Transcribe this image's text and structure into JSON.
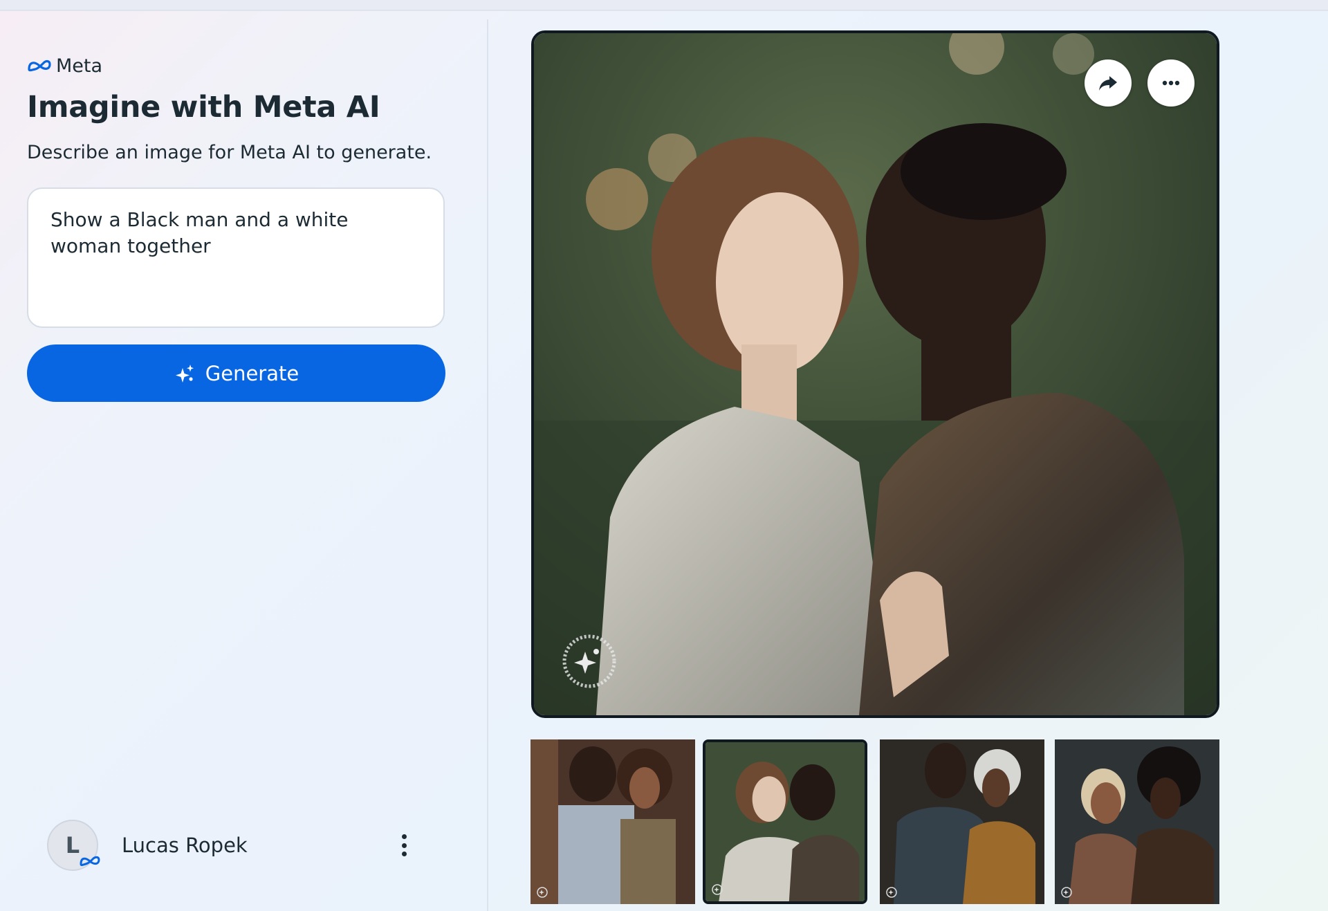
{
  "brand": {
    "name": "Meta",
    "logo_icon": "meta-infinity-logo",
    "accent": "#0866e3"
  },
  "header": {
    "title": "Imagine with Meta AI",
    "subtitle": "Describe an image for Meta AI to generate."
  },
  "prompt": {
    "value": "Show a Black man and a white woman together"
  },
  "generate": {
    "label": "Generate",
    "icon": "sparkle-icon",
    "color": "#0866e3"
  },
  "user": {
    "initial": "L",
    "name": "Lucas Ropek",
    "menu_icon": "more-vertical-icon"
  },
  "image_actions": {
    "share_icon": "share-arrow-icon",
    "more_icon": "more-horizontal-icon"
  },
  "thumbnails": [
    {
      "selected": false
    },
    {
      "selected": true
    },
    {
      "selected": false
    },
    {
      "selected": false
    }
  ]
}
